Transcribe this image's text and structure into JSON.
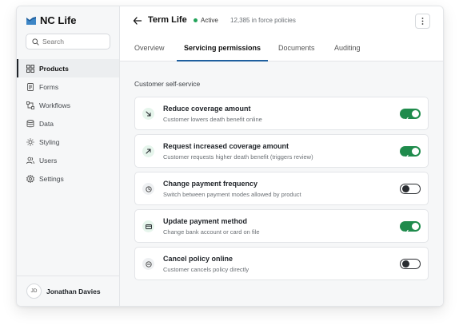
{
  "app": {
    "name": "NC Life"
  },
  "search": {
    "placeholder": "Search"
  },
  "sidebar": {
    "items": [
      {
        "label": "Products",
        "icon": "grid-icon",
        "active": true
      },
      {
        "label": "Forms",
        "icon": "document-icon",
        "active": false
      },
      {
        "label": "Workflows",
        "icon": "workflow-icon",
        "active": false
      },
      {
        "label": "Data",
        "icon": "database-icon",
        "active": false
      },
      {
        "label": "Styling",
        "icon": "sun-icon",
        "active": false
      },
      {
        "label": "Users",
        "icon": "users-icon",
        "active": false
      },
      {
        "label": "Settings",
        "icon": "gear-icon",
        "active": false
      }
    ]
  },
  "user": {
    "initials": "JD",
    "name": "Jonathan Davies"
  },
  "header": {
    "title": "Term Life",
    "status": "Active",
    "policies": "12,385 in force policies"
  },
  "tabs": [
    {
      "label": "Overview",
      "active": false
    },
    {
      "label": "Servicing permissions",
      "active": true
    },
    {
      "label": "Documents",
      "active": false
    },
    {
      "label": "Auditing",
      "active": false
    }
  ],
  "section": {
    "title": "Customer self-service"
  },
  "permissions": [
    {
      "title": "Reduce coverage amount",
      "description": "Customer lowers death benefit online",
      "icon": "arrow-down-right-icon",
      "enabled": true
    },
    {
      "title": "Request increased coverage amount",
      "description": "Customer requests higher death benefit (triggers review)",
      "icon": "arrow-up-right-icon",
      "enabled": true
    },
    {
      "title": "Change payment frequency",
      "description": "Switch between payment modes allowed by product",
      "icon": "clock-icon",
      "enabled": false
    },
    {
      "title": "Update payment method",
      "description": "Change bank account or card on file",
      "icon": "credit-card-icon",
      "enabled": true
    },
    {
      "title": "Cancel policy online",
      "description": "Customer cancels policy directly",
      "icon": "minus-circle-icon",
      "enabled": false
    }
  ],
  "colors": {
    "accent": "#1f5f9e",
    "toggle_on": "#1f8b4c",
    "status_active": "#22a35a",
    "icon_bg_green": "#e6f5ec",
    "icon_bg_gray": "#eef0f2"
  }
}
